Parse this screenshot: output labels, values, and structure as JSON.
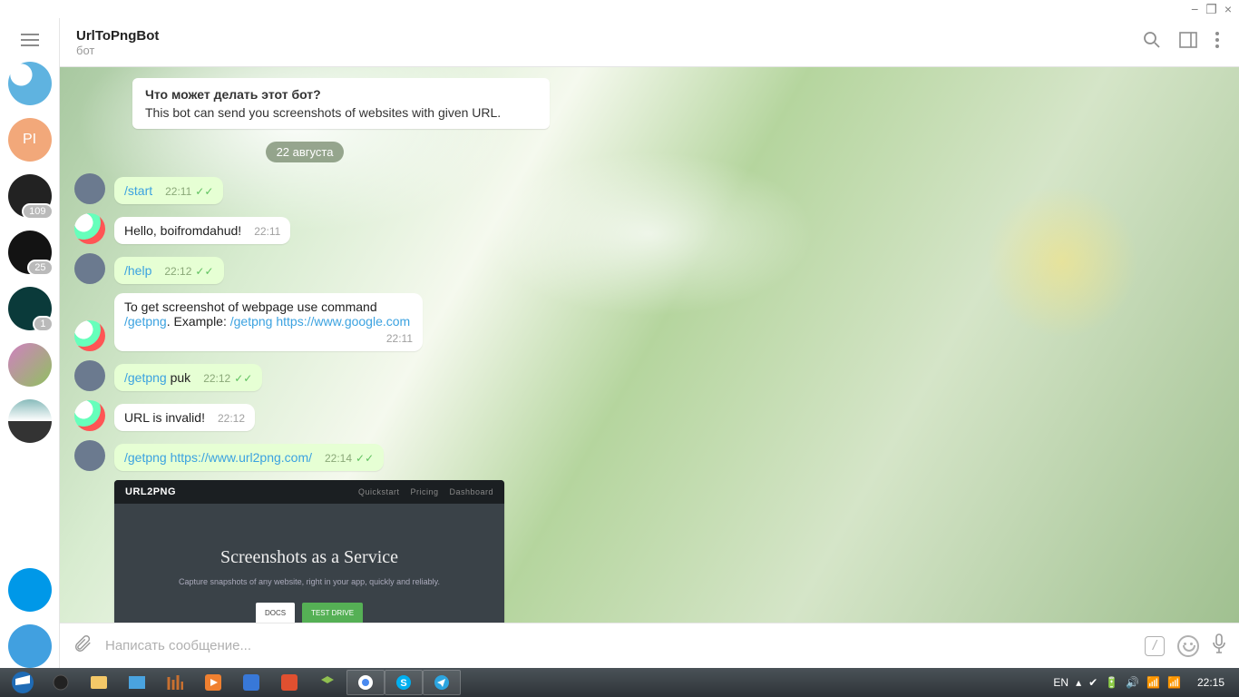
{
  "window_controls": {
    "min": "−",
    "max": "❐",
    "close": "×"
  },
  "header": {
    "title": "UrlToPngBot",
    "subtitle": "бот"
  },
  "sidebar": {
    "items": [
      {
        "badge": null
      },
      {
        "label": "PI"
      },
      {
        "badge": "109"
      },
      {
        "badge": "25"
      },
      {
        "badge": "1"
      },
      {},
      {},
      {},
      {},
      {},
      {}
    ]
  },
  "intro": {
    "question": "Что может делать этот бот?",
    "description": "This bot can send you screenshots of websites with given URL."
  },
  "date_separator": "22 августа",
  "messages": [
    {
      "side": "out",
      "cmd": "/start",
      "text": "",
      "time": "22:11",
      "ticks": true
    },
    {
      "side": "in",
      "text": "Hello, boifromdahud!",
      "time": "22:11"
    },
    {
      "side": "out",
      "cmd": "/help",
      "text": "",
      "time": "22:12",
      "ticks": true
    },
    {
      "side": "in",
      "html_pre": "To get screenshot of webpage use command ",
      "cmd1": "/getpng",
      "mid": ". Example: ",
      "cmd2": "/getpng https://www.google.com",
      "time": "22:11",
      "multi": true
    },
    {
      "side": "out",
      "cmd": "/getpng",
      "text": " puk",
      "time": "22:12",
      "ticks": true
    },
    {
      "side": "in",
      "text": "URL is invalid!",
      "time": "22:12"
    },
    {
      "side": "out",
      "cmd": "/getpng https://www.url2png.com/",
      "text": "",
      "time": "22:14",
      "ticks": true
    }
  ],
  "preview": {
    "brand": "URL2PNG",
    "nav": [
      "Quickstart",
      "Pricing",
      "Dashboard"
    ],
    "headline": "Screenshots as a Service",
    "tagline": "Capture snapshots of any website, right in your app, quickly and reliably.",
    "btn_docs": "DOCS",
    "btn_test": "TEST DRIVE"
  },
  "composer": {
    "placeholder": "Написать сообщение..."
  },
  "taskbar": {
    "lang": "EN",
    "clock": "22:15"
  }
}
